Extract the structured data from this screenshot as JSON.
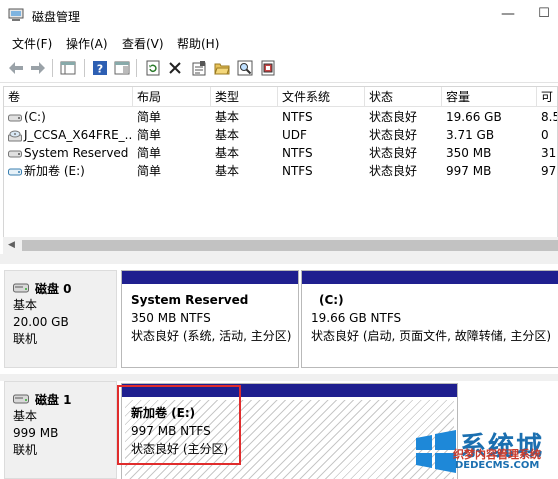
{
  "window": {
    "title": "磁盘管理"
  },
  "menu": [
    "文件(F)",
    "操作(A)",
    "查看(V)",
    "帮助(H)"
  ],
  "table": {
    "columns": [
      "卷",
      "布局",
      "类型",
      "文件系统",
      "状态",
      "容量",
      "可"
    ],
    "rows": [
      {
        "name": "(C:)",
        "layout": "简单",
        "type": "基本",
        "fs": "NTFS",
        "status": "状态良好",
        "capacity": "19.66 GB",
        "free": "8.5"
      },
      {
        "name": "J_CCSA_X64FRE_...",
        "layout": "简单",
        "type": "基本",
        "fs": "UDF",
        "status": "状态良好",
        "capacity": "3.71 GB",
        "free": "0"
      },
      {
        "name": "System Reserved",
        "layout": "简单",
        "type": "基本",
        "fs": "NTFS",
        "status": "状态良好",
        "capacity": "350 MB",
        "free": "31"
      },
      {
        "name": "新加卷 (E:)",
        "layout": "简单",
        "type": "基本",
        "fs": "NTFS",
        "status": "状态良好",
        "capacity": "997 MB",
        "free": "97"
      }
    ]
  },
  "disks": [
    {
      "name": "磁盘 0",
      "type": "基本",
      "size": "20.00 GB",
      "status": "联机",
      "partitions": [
        {
          "title": "System Reserved",
          "size_fs": "350 MB NTFS",
          "status": "状态良好 (系统, 活动, 主分区)"
        },
        {
          "title": "(C:)",
          "size_fs": "19.66 GB NTFS",
          "status": "状态良好 (启动, 页面文件, 故障转储, 主分区)"
        }
      ]
    },
    {
      "name": "磁盘 1",
      "type": "基本",
      "size": "999 MB",
      "status": "联机",
      "partitions": [
        {
          "title": "新加卷  (E:)",
          "size_fs": "997 MB NTFS",
          "status": "状态良好 (主分区)"
        }
      ]
    }
  ],
  "watermark": {
    "big": "系统城",
    "sub": "织梦内容管理系统",
    "url": "DEDECMS.COM"
  },
  "colors": {
    "partition_header": "#1f1f8f",
    "highlight_box": "#e02c2c"
  }
}
